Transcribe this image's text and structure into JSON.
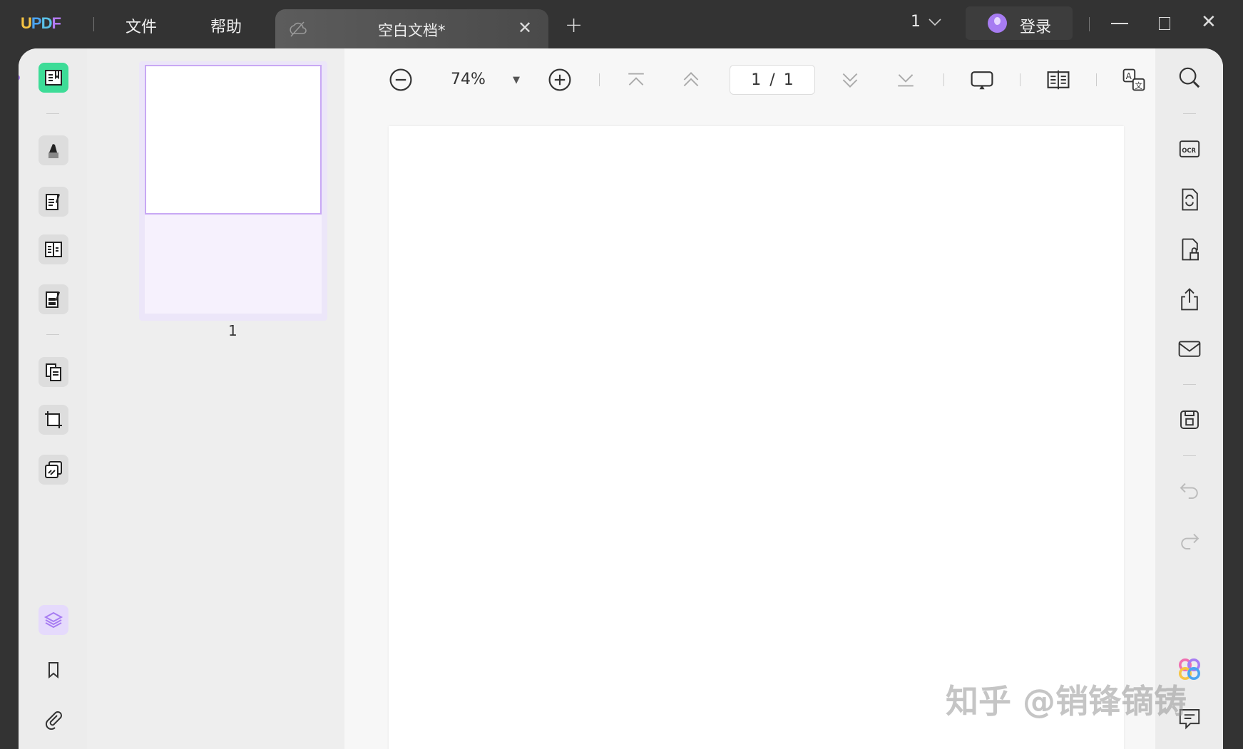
{
  "titlebar": {
    "logo": "UPDF",
    "menu": [
      "文件",
      "帮助"
    ],
    "tab_title": "空白文档*",
    "window_count": "1",
    "login": "登录"
  },
  "toolbar": {
    "zoom": "74%",
    "page_current": "1",
    "page_total": "1",
    "page_sep": "/"
  },
  "thumbnails": [
    {
      "label": "1"
    }
  ],
  "watermark": "知乎 @销锋镝铸",
  "colors": {
    "accent": "#a77cf2",
    "reader_active": "#3ddc97"
  }
}
